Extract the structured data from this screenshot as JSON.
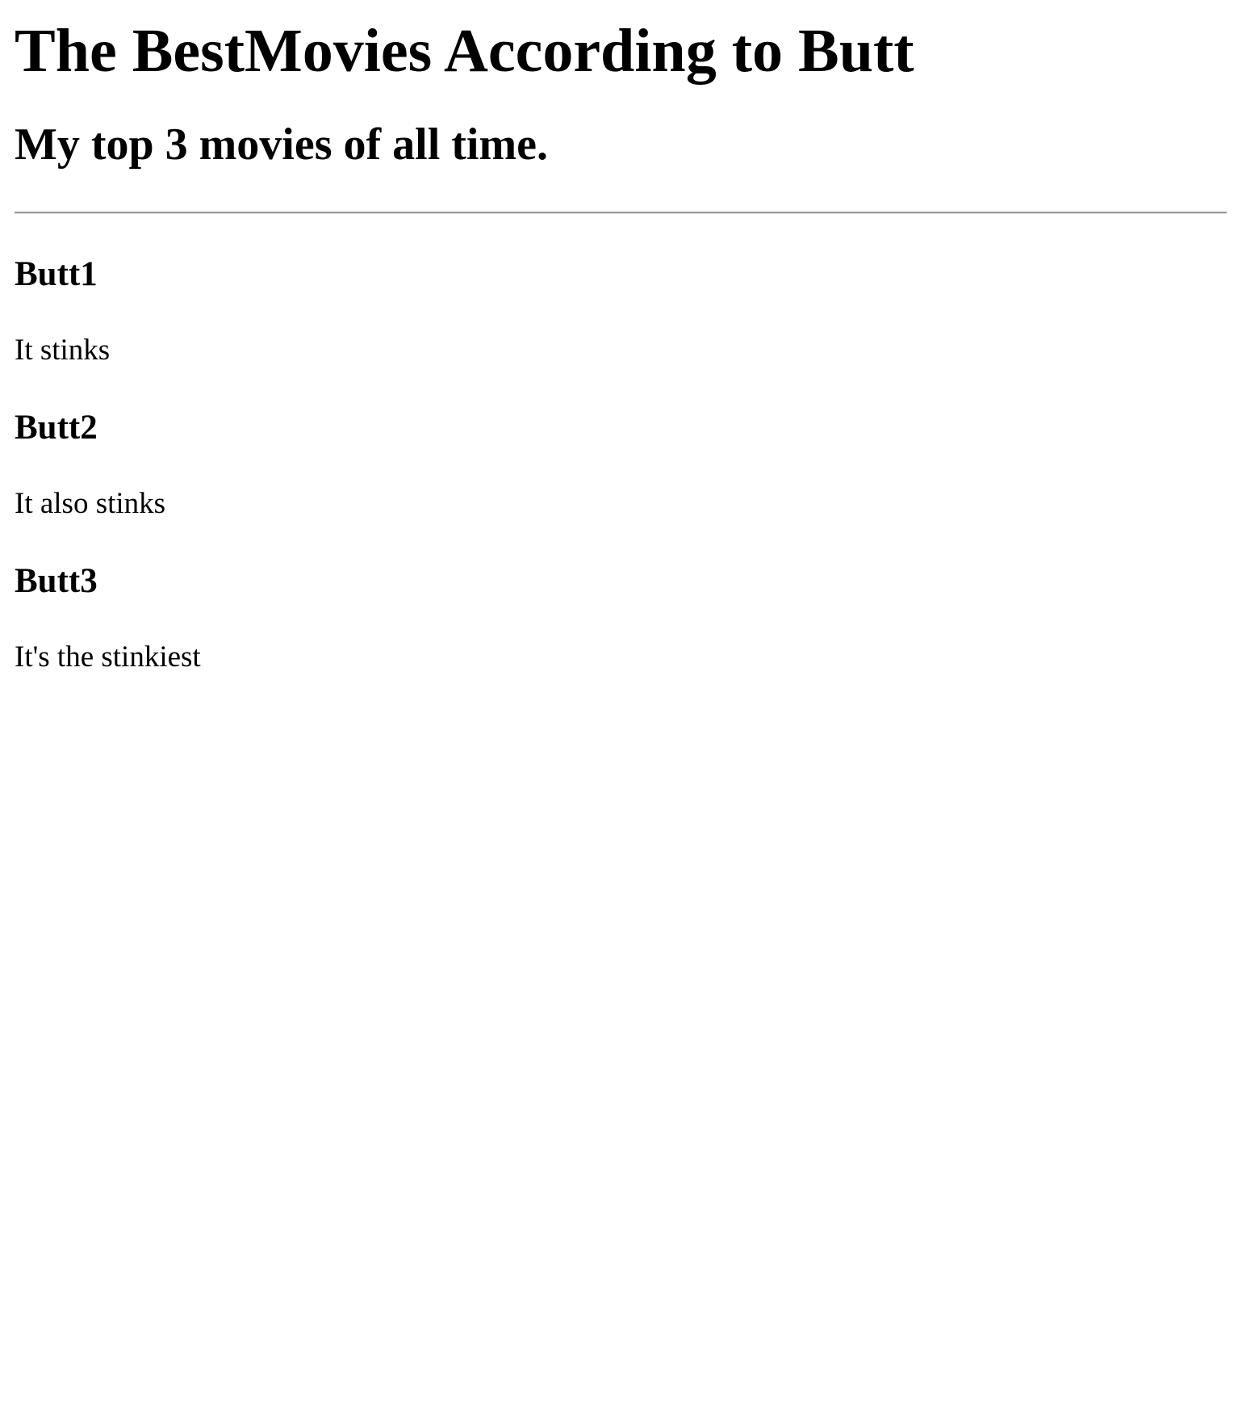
{
  "header": {
    "title": "The BestMovies According to Butt",
    "subtitle": "My top 3 movies of all time."
  },
  "movies": [
    {
      "title": "Butt1",
      "review": "It stinks"
    },
    {
      "title": "Butt2",
      "review": "It also stinks"
    },
    {
      "title": "Butt3",
      "review": "It's the stinkiest"
    }
  ],
  "colors": {
    "text": "#000000",
    "background": "#ffffff",
    "divider": "#999999"
  }
}
